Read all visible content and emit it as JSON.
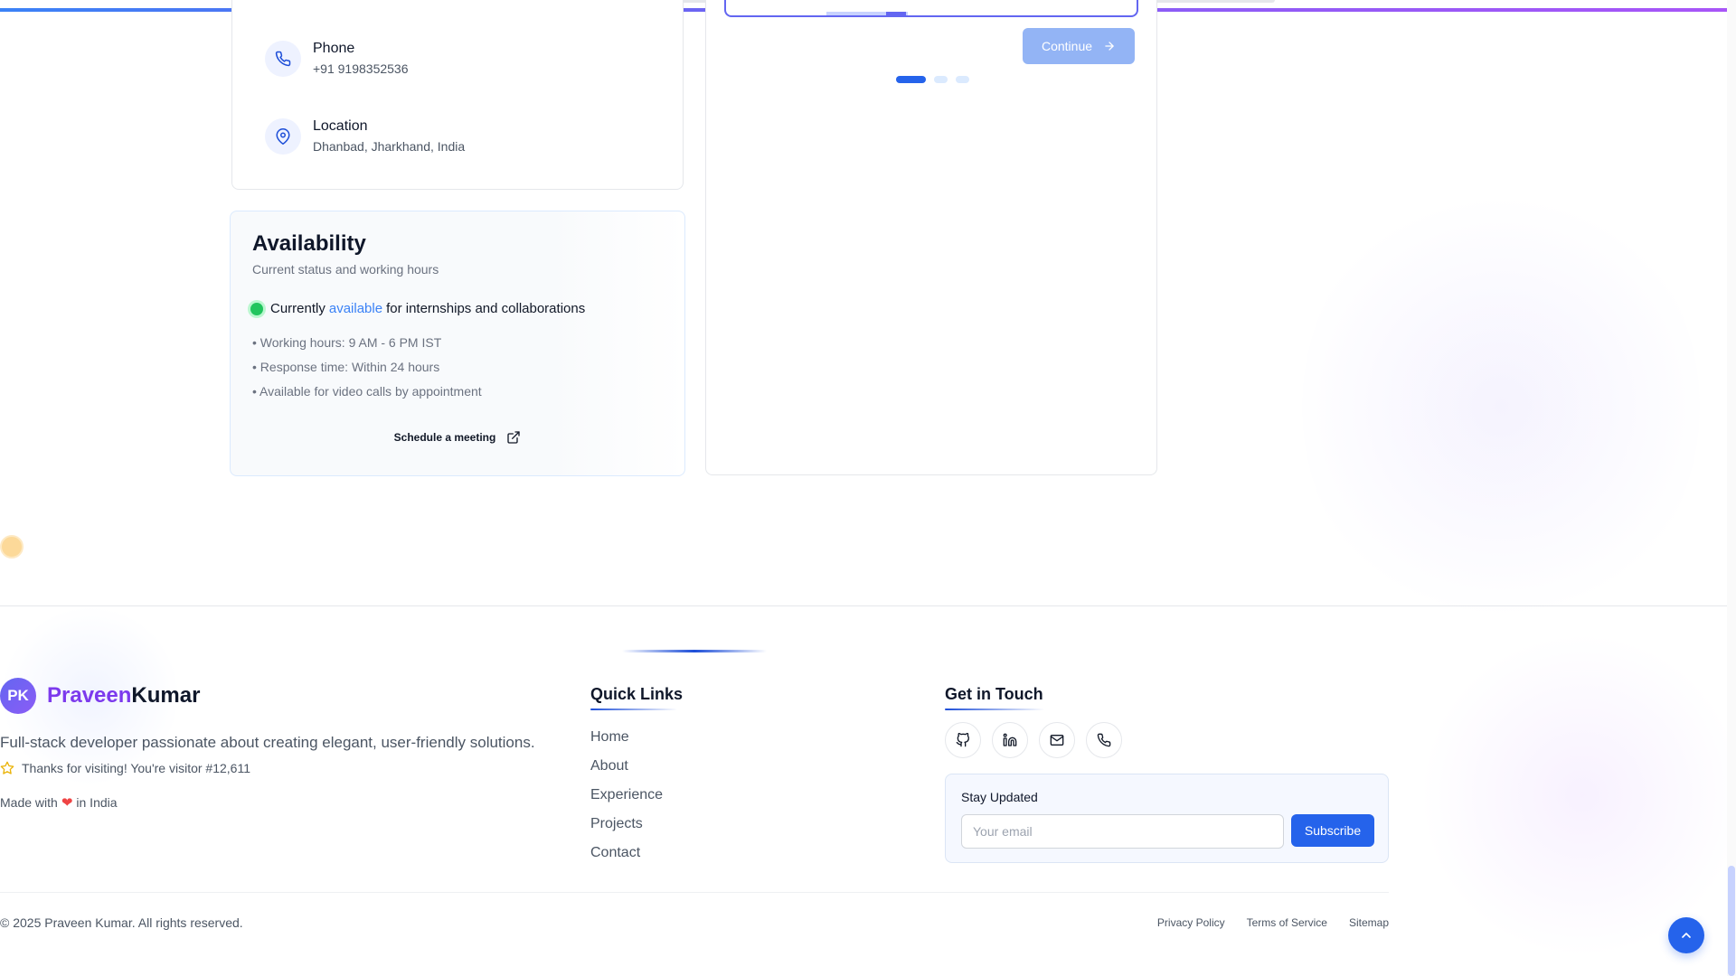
{
  "contact": {
    "phone": {
      "title": "Phone",
      "value": "+91 9198352536",
      "icon": "phone-icon"
    },
    "location": {
      "title": "Location",
      "value": "Dhanbad, Jharkhand, India",
      "icon": "map-pin-icon"
    }
  },
  "availability": {
    "title": "Availability",
    "subtitle": "Current status and working hours",
    "status_prefix": "Currently",
    "status_accent": "available",
    "status_suffix": "for internships and collaborations",
    "items": [
      "• Working hours: 9 AM - 6 PM IST",
      "• Response time: Within 24 hours",
      "• Available for video calls by appointment"
    ],
    "schedule_label": "Schedule a meeting"
  },
  "form": {
    "continue_label": "Continue",
    "steps_total": 3,
    "step_active": 1
  },
  "footer": {
    "brand": {
      "initials": "PK",
      "first": "Praveen",
      "last": "Kumar"
    },
    "description": "Full-stack developer passionate about creating elegant, user-friendly solutions.",
    "visitor_text": "Thanks for visiting! You're visitor #12,611",
    "made_with_prefix": "Made with",
    "made_with_suffix": "in India",
    "quick_links_title": "Quick Links",
    "quick_links": [
      "Home",
      "About",
      "Experience",
      "Projects",
      "Contact"
    ],
    "get_in_touch_title": "Get in Touch",
    "social_icons": [
      "github-icon",
      "linkedin-icon",
      "mail-icon",
      "phone-icon"
    ],
    "newsletter": {
      "title": "Stay Updated",
      "placeholder": "Your email",
      "button": "Subscribe"
    },
    "copyright": "© 2025 Praveen Kumar. All rights reserved.",
    "legal_links": [
      "Privacy Policy",
      "Terms of Service",
      "Sitemap"
    ]
  },
  "colors": {
    "accent": "#2563eb",
    "brand_purple": "#7c3aed",
    "available_green": "#22c55e"
  }
}
